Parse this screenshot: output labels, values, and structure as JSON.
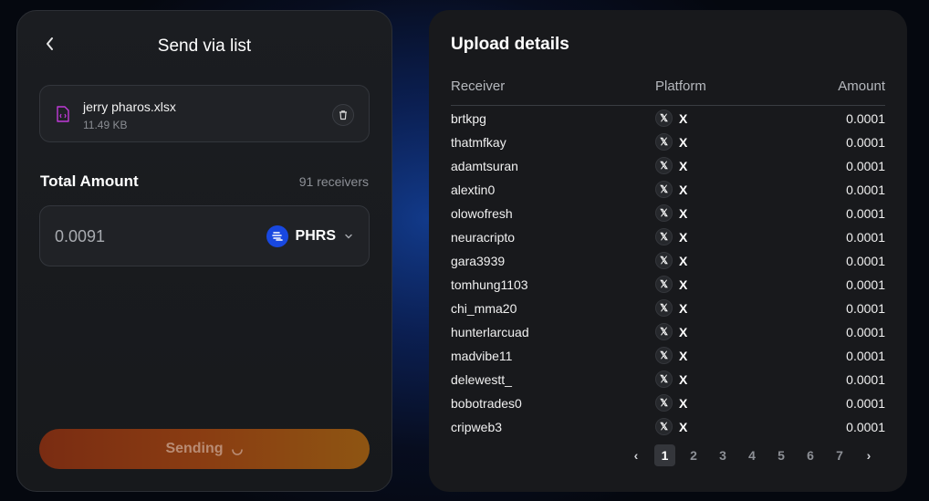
{
  "send_panel": {
    "title": "Send via list",
    "back_icon": "chevron-left-icon",
    "file": {
      "name": "jerry pharos.xlsx",
      "size": "11.49 KB",
      "icon": "spreadsheet-file-icon",
      "delete_icon": "trash-icon"
    },
    "total_amount_label": "Total Amount",
    "receivers_count": "91 receivers",
    "amount_value": "0.0091",
    "token": {
      "symbol": "PHRS",
      "logo_color": "#1848e0"
    },
    "send_button_label": "Sending",
    "accent_gradient": [
      "#7a2c12",
      "#8e5512"
    ]
  },
  "upload_panel": {
    "title": "Upload details",
    "columns": [
      "Receiver",
      "Platform",
      "Amount"
    ],
    "rows": [
      {
        "receiver": "brtkpg",
        "platform": "X",
        "amount": "0.0001"
      },
      {
        "receiver": "thatmfkay",
        "platform": "X",
        "amount": "0.0001"
      },
      {
        "receiver": "adamtsuran",
        "platform": "X",
        "amount": "0.0001"
      },
      {
        "receiver": "alextin0",
        "platform": "X",
        "amount": "0.0001"
      },
      {
        "receiver": "olowofresh",
        "platform": "X",
        "amount": "0.0001"
      },
      {
        "receiver": "neuracripto",
        "platform": "X",
        "amount": "0.0001"
      },
      {
        "receiver": "gara3939",
        "platform": "X",
        "amount": "0.0001"
      },
      {
        "receiver": "tomhung1103",
        "platform": "X",
        "amount": "0.0001"
      },
      {
        "receiver": "chi_mma20",
        "platform": "X",
        "amount": "0.0001"
      },
      {
        "receiver": "hunterlarcuad",
        "platform": "X",
        "amount": "0.0001"
      },
      {
        "receiver": "madvibe11",
        "platform": "X",
        "amount": "0.0001"
      },
      {
        "receiver": "delewestt_",
        "platform": "X",
        "amount": "0.0001"
      },
      {
        "receiver": "bobotrades0",
        "platform": "X",
        "amount": "0.0001"
      },
      {
        "receiver": "cripweb3",
        "platform": "X",
        "amount": "0.0001"
      }
    ],
    "pagination": {
      "prev": "‹",
      "pages": [
        "1",
        "2",
        "3",
        "4",
        "5",
        "6",
        "7"
      ],
      "current": "1",
      "next": "›"
    }
  }
}
